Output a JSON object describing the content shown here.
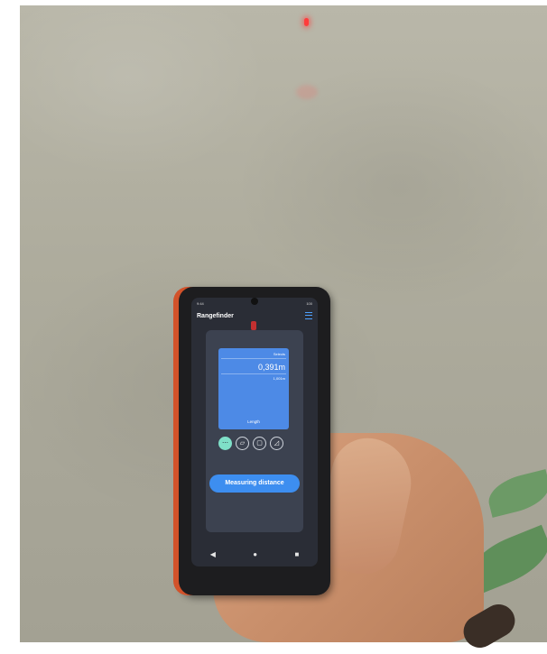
{
  "app": {
    "title": "Rangefinder"
  },
  "status_bar": {
    "left": "9:44",
    "right": "100"
  },
  "readout": {
    "top_label": "Selects",
    "main_value": "0,391m",
    "secondary_value": "1,001m",
    "mode_label": "Length"
  },
  "tools": [
    {
      "icon": "length-icon",
      "glyph": "⋯",
      "active": true
    },
    {
      "icon": "area-icon",
      "glyph": "▱",
      "active": false
    },
    {
      "icon": "volume-icon",
      "glyph": "▢",
      "active": false
    },
    {
      "icon": "angle-icon",
      "glyph": "◿",
      "active": false
    }
  ],
  "action_button": {
    "label": "Measuring distance"
  },
  "navigation": {
    "back": "◀",
    "home": "●",
    "recents": "■"
  },
  "colors": {
    "accent": "#3d8ef0",
    "panel": "#4d8ae6",
    "active_tool": "#7fe0c8",
    "laser": "#ff3b3b",
    "phone_bumper": "#d2522a"
  }
}
